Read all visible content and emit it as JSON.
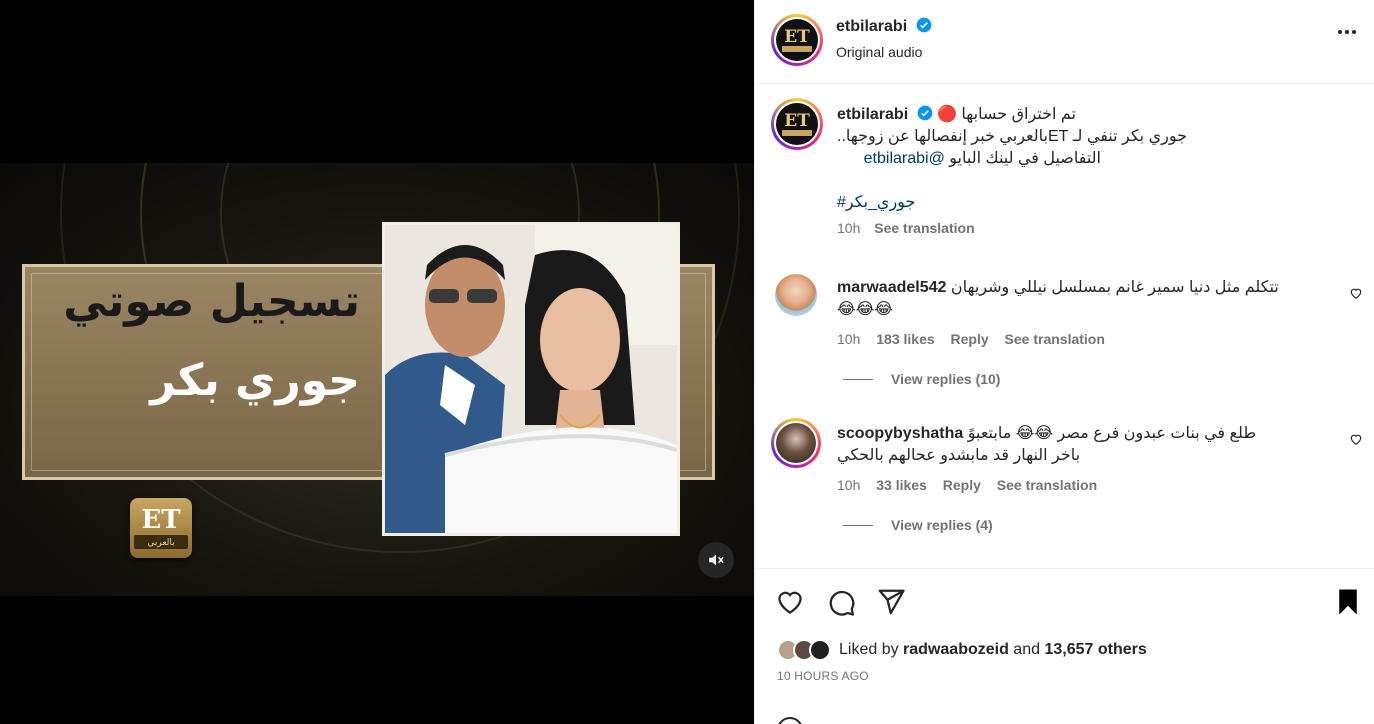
{
  "video": {
    "title_text": "تسجيل صوتي",
    "name_text": "جوري بكر",
    "logo_text": "ET",
    "logo_sub": "بالعربي"
  },
  "header": {
    "username": "etbilarabi",
    "subtitle": "Original audio"
  },
  "caption": {
    "username": "etbilarabi",
    "line1": "تم اختراق حسابها 🔴",
    "line2": "جوري بكر تنفي لـ ETبالعربي خبر إنفصالها عن زوجها..",
    "line3_text": "التفاصيل في لينك البايو ",
    "line3_mention": "@etbilarabi",
    "hashtag": "#جوري_بكر",
    "time": "10h",
    "see_translation": "See translation"
  },
  "comments": [
    {
      "username": "marwaadel542",
      "text": "تتكلم مثل دنيا سمير غانم بمسلسل نيللي وشريهان",
      "text2": "😂😂😂",
      "time": "10h",
      "likes": "183 likes",
      "reply": "Reply",
      "see_translation": "See translation",
      "view_replies": "View replies (10)"
    },
    {
      "username": "scoopybyshatha",
      "text": "طلع في بنات عبدون فرع مصر 😂😂 مابتعبوً",
      "text2": "باخر النهار قد مابشدو عحالهم بالحكي",
      "time": "10h",
      "likes": "33 likes",
      "reply": "Reply",
      "see_translation": "See translation",
      "view_replies": "View replies (4)"
    }
  ],
  "likes": {
    "prefix": "Liked by ",
    "user": "radwaabozeid",
    "middle": " and ",
    "others": "13,657 others",
    "time_ago": "10 HOURS AGO"
  },
  "colors": {
    "verified": "#0095f6",
    "gold": "#c9a660",
    "link": "#00376b"
  }
}
